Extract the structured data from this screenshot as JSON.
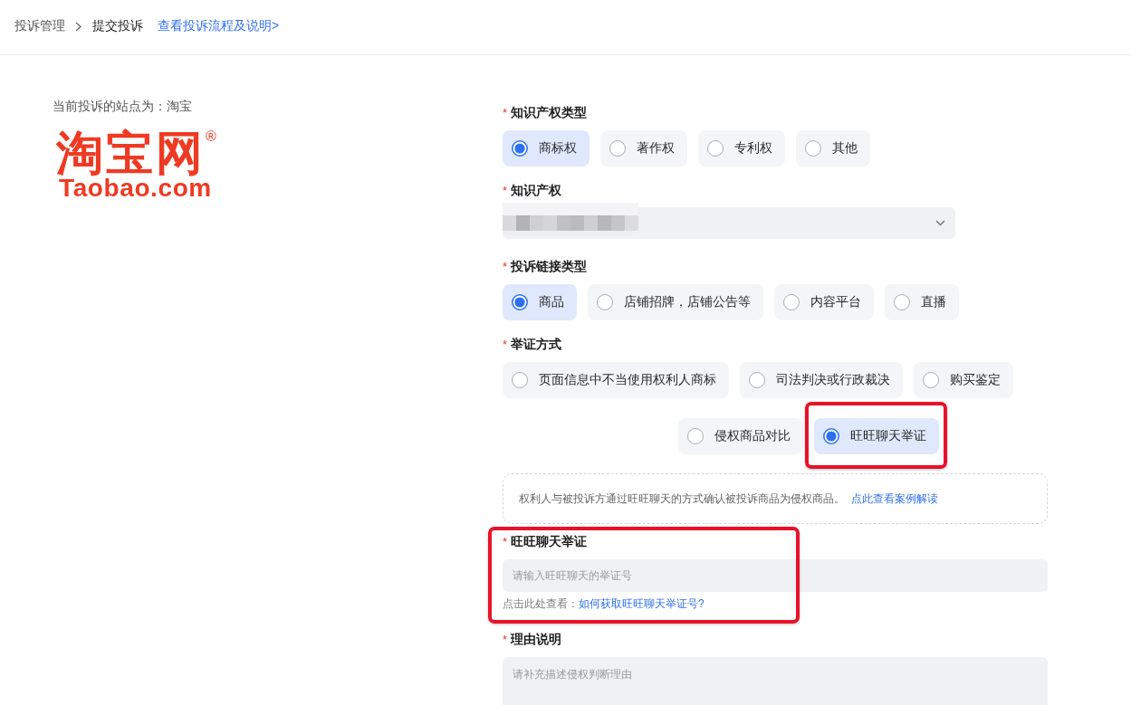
{
  "breadcrumb": {
    "items": [
      {
        "label": "投诉管理",
        "current": false
      },
      {
        "label": "提交投诉",
        "current": true
      }
    ],
    "help_link": "查看投诉流程及说明>"
  },
  "site": {
    "label": "当前投诉的站点为：淘宝",
    "logo": {
      "wordmark": "淘宝网",
      "registered": "®",
      "domain": "Taobao.com"
    }
  },
  "form": [
    {
      "kind": "radio",
      "required_mark": "*",
      "label": "知识产权类型",
      "highlighted": false,
      "rows": [
        [
          {
            "label": "商标权",
            "selected": true,
            "highlighted": false
          },
          {
            "label": "著作权",
            "selected": false,
            "highlighted": false
          },
          {
            "label": "专利权",
            "selected": false,
            "highlighted": false
          },
          {
            "label": "其他",
            "selected": false,
            "highlighted": false
          }
        ]
      ]
    },
    {
      "kind": "select",
      "required_mark": "*",
      "label": "知识产权",
      "highlighted": false,
      "redacted": true
    },
    {
      "kind": "radio",
      "required_mark": "*",
      "label": "投诉链接类型",
      "highlighted": false,
      "rows": [
        [
          {
            "label": "商品",
            "selected": true,
            "highlighted": false
          },
          {
            "label": "店铺招牌，店铺公告等",
            "selected": false,
            "highlighted": false
          },
          {
            "label": "内容平台",
            "selected": false,
            "highlighted": false
          },
          {
            "label": "直播",
            "selected": false,
            "highlighted": false
          }
        ]
      ]
    },
    {
      "kind": "radio",
      "required_mark": "*",
      "label": "举证方式",
      "highlighted": false,
      "rows": [
        [
          {
            "label": "页面信息中不当使用权利人商标",
            "selected": false,
            "highlighted": false
          },
          {
            "label": "司法判决或行政裁决",
            "selected": false,
            "highlighted": false
          },
          {
            "label": "购买鉴定",
            "selected": false,
            "highlighted": false
          }
        ],
        [
          {
            "label": "侵权商品对比",
            "selected": false,
            "highlighted": false
          },
          {
            "label": "旺旺聊天举证",
            "selected": true,
            "highlighted": true
          }
        ]
      ],
      "note": {
        "text": "权利人与被投诉方通过旺旺聊天的方式确认被投诉商品为侵权商品。",
        "link": "点此查看案例解读"
      }
    },
    {
      "kind": "input",
      "required_mark": "*",
      "label": "旺旺聊天举证",
      "highlighted": true,
      "placeholder": "请输入旺旺聊天的举证号",
      "help": {
        "text": "点击此处查看：",
        "link": "如何获取旺旺聊天举证号?"
      }
    },
    {
      "kind": "textarea",
      "required_mark": "*",
      "label": "理由说明",
      "highlighted": false,
      "placeholder": "请补充描述侵权判断理由"
    }
  ]
}
